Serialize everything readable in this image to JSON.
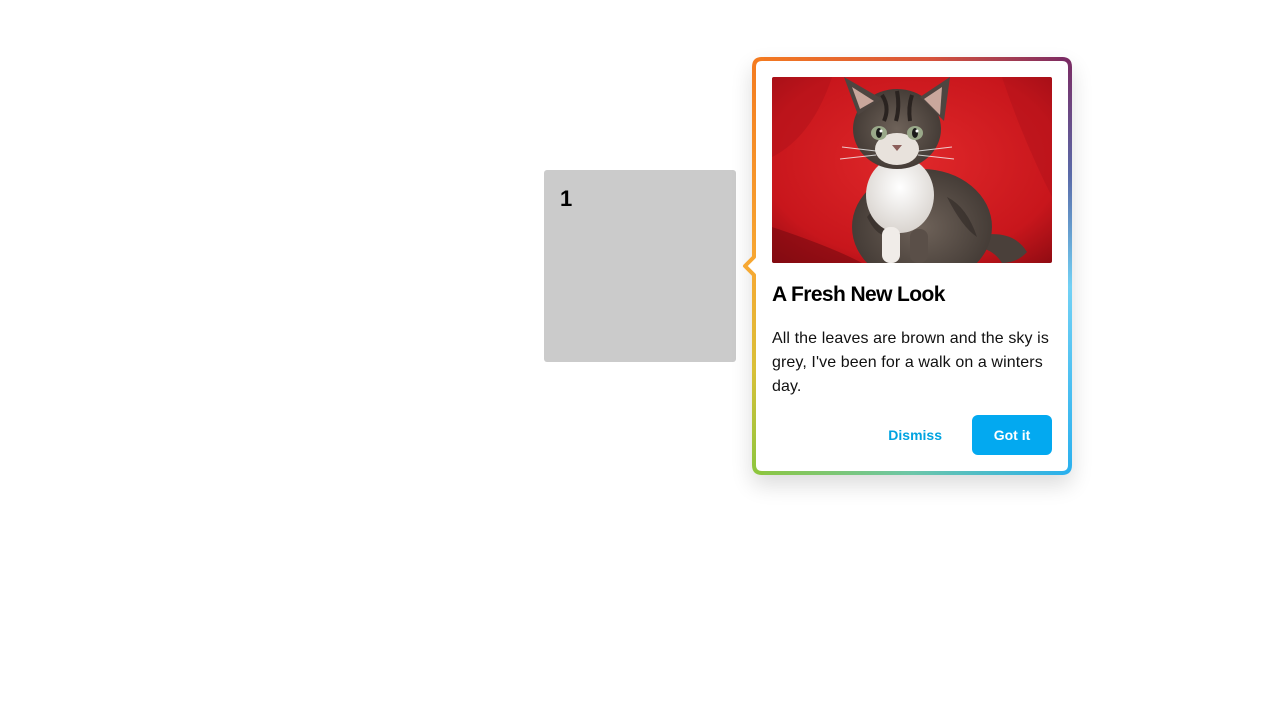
{
  "target": {
    "number": "1"
  },
  "tooltip": {
    "image_alt": "kitten",
    "title": "A Fresh New Look",
    "body": "All the leaves are brown and the sky is grey, I've been for a walk on a winters day.",
    "dismiss_label": "Dismiss",
    "confirm_label": "Got it"
  },
  "colors": {
    "accent": "#03a9f0",
    "border_gradient": [
      "#f47b20",
      "#a83a5a",
      "#5b2d6e",
      "#5bc8f5",
      "#33b3f0",
      "#8dc63f",
      "#f7941d"
    ],
    "target_box": "#cbcbcb"
  }
}
